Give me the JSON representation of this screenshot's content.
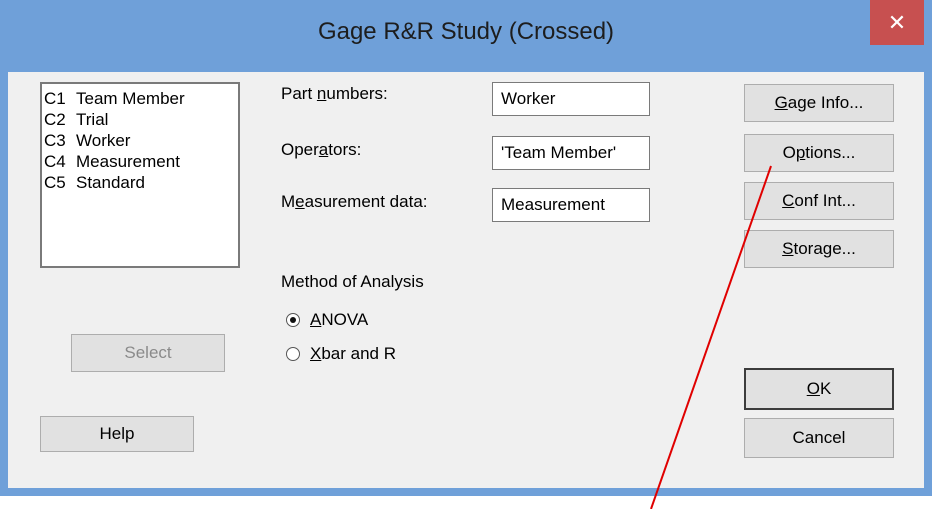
{
  "window": {
    "title": "Gage R&R Study (Crossed)",
    "close_symbol": "✕"
  },
  "columns": [
    {
      "id": "C1",
      "name": "Team Member"
    },
    {
      "id": "C2",
      "name": "Trial"
    },
    {
      "id": "C3",
      "name": "Worker"
    },
    {
      "id": "C4",
      "name": "Measurement"
    },
    {
      "id": "C5",
      "name": "Standard"
    }
  ],
  "fields": {
    "part_numbers": {
      "label_pre": "Part ",
      "label_key": "n",
      "label_post": "umbers:",
      "value": "Worker"
    },
    "operators": {
      "label_pre": "Oper",
      "label_key": "a",
      "label_post": "tors:",
      "value": "'Team Member'"
    },
    "measurement": {
      "label_pre": "M",
      "label_key": "e",
      "label_post": "asurement data:",
      "value": "Measurement"
    }
  },
  "method": {
    "label": "Method of Analysis",
    "options": [
      {
        "key": "A",
        "rest": "NOVA",
        "checked": true
      },
      {
        "key": "X",
        "rest": "bar and R",
        "checked": false
      }
    ]
  },
  "buttons": {
    "select": "Select",
    "help": "Help",
    "gage_info": {
      "key": "G",
      "rest": "age Info..."
    },
    "options": {
      "pre": "O",
      "key": "p",
      "rest": "tions..."
    },
    "conf_int": {
      "key": "C",
      "rest": "onf Int..."
    },
    "storage": {
      "key": "S",
      "rest": "torage..."
    },
    "ok": {
      "key": "O",
      "rest": "K"
    },
    "cancel": "Cancel"
  },
  "colors": {
    "title_bar": "#6fa0d9",
    "close_button": "#c75050",
    "annotation_line": "#e00000"
  }
}
